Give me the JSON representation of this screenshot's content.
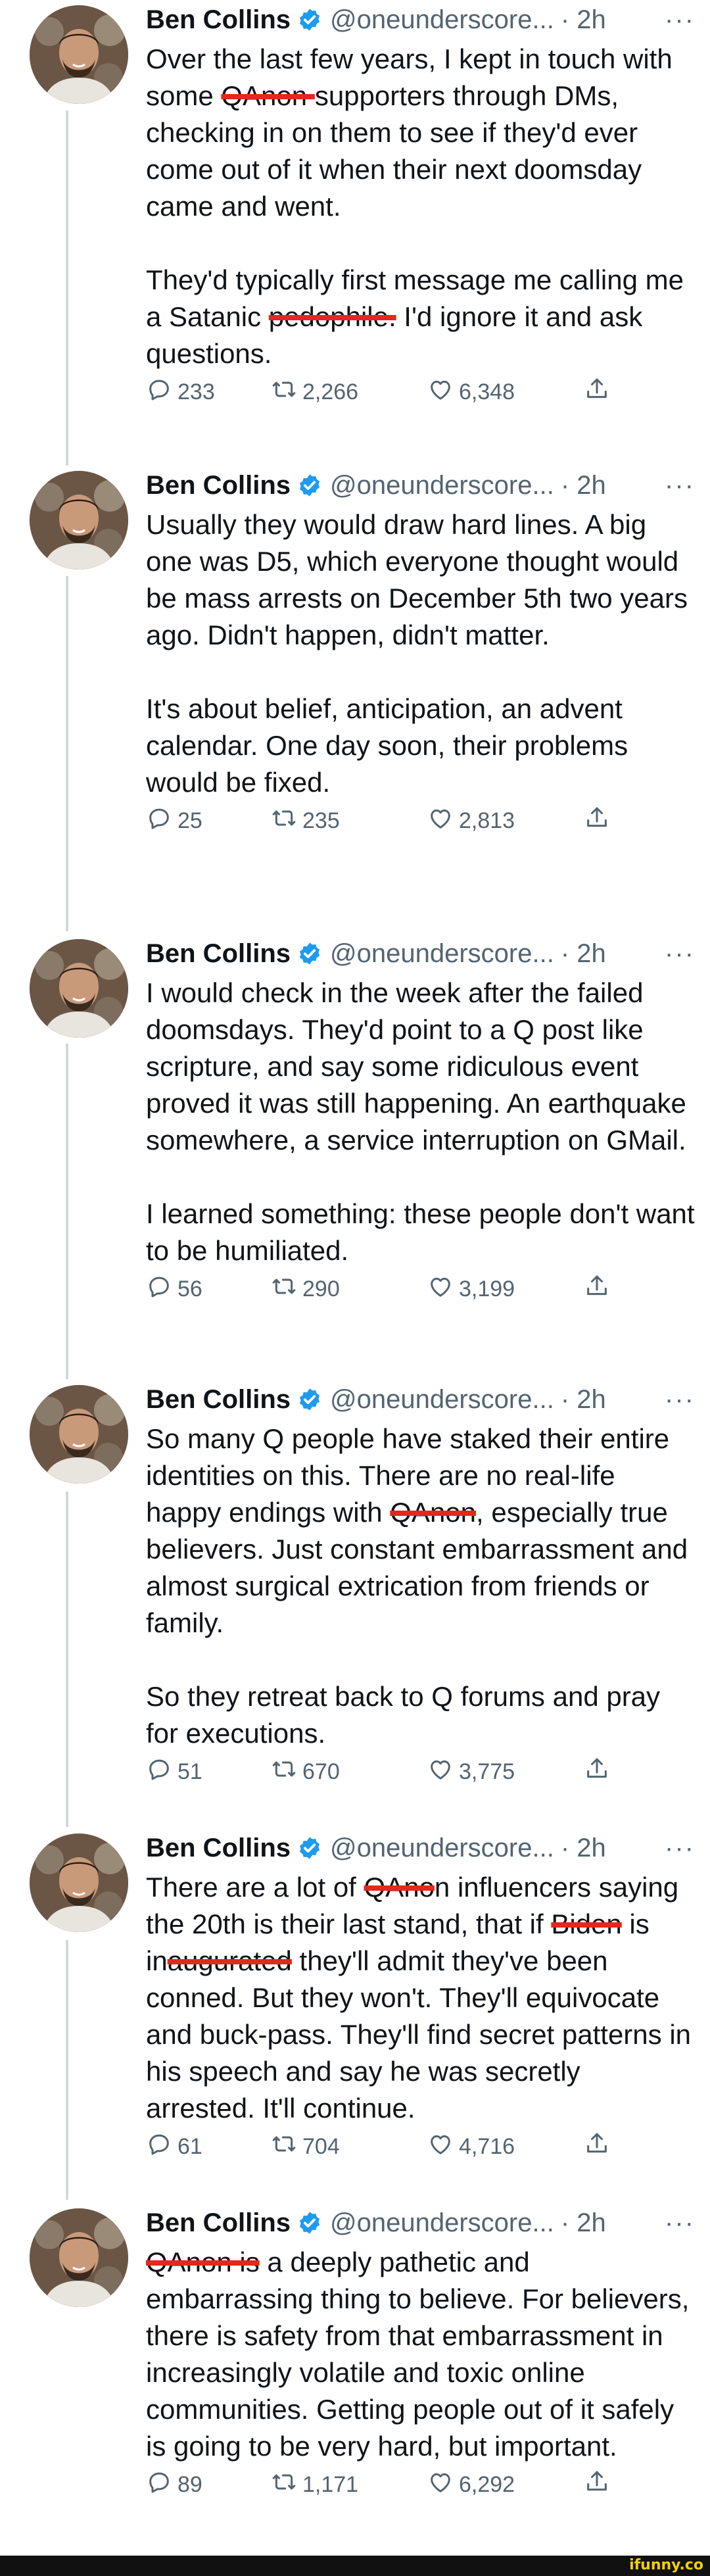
{
  "colors": {
    "accent": "#1d9bf0",
    "redaction": "#e3281c",
    "secondary_text": "#536471"
  },
  "tweets": [
    {
      "name": "Ben Collins",
      "handle": "@oneunderscore...",
      "time": "· 2h",
      "more": "···",
      "segments": [
        {
          "t": "Over the last few years, I kept in touch with some "
        },
        {
          "t": "QAnon ",
          "r": true
        },
        {
          "t": "supporters through DMs, checking in on them to see if they'd ever come out of it when their next doomsday came and went.\n\nThey'd typically first message me calling me a Satanic "
        },
        {
          "t": "pedophile.",
          "r": true
        },
        {
          "t": " I'd ignore it and ask questions."
        }
      ],
      "replies": "233",
      "retweets": "2,266",
      "likes": "6,348"
    },
    {
      "name": "Ben Collins",
      "handle": "@oneunderscore...",
      "time": "· 2h",
      "more": "···",
      "segments": [
        {
          "t": "Usually they would draw hard lines. A big one was D5, which everyone thought would be mass arrests on December 5th two years ago. Didn't happen, didn't matter.\n\nIt's about belief, anticipation, an advent calendar. One day soon, their problems would be fixed."
        }
      ],
      "replies": "25",
      "retweets": "235",
      "likes": "2,813"
    },
    {
      "name": "Ben Collins",
      "handle": "@oneunderscore...",
      "time": "· 2h",
      "more": "···",
      "segments": [
        {
          "t": "I would check in the week after the failed doomsdays. They'd point to a Q post like scripture, and say some ridiculous event proved it was still happening. An earthquake somewhere, a service interruption on GMail.\n\nI learned something: these people don't want to be humiliated."
        }
      ],
      "replies": "56",
      "retweets": "290",
      "likes": "3,199"
    },
    {
      "name": "Ben Collins",
      "handle": "@oneunderscore...",
      "time": "· 2h",
      "more": "···",
      "segments": [
        {
          "t": "So many Q people have staked their entire identities on this. There are no real-life happy endings with "
        },
        {
          "t": "QAnon",
          "r": true
        },
        {
          "t": ", especially true believers. Just constant embarrassment and almost surgical extrication from friends or family.\n\nSo they retreat back to Q forums and pray for executions."
        }
      ],
      "replies": "51",
      "retweets": "670",
      "likes": "3,775"
    },
    {
      "name": "Ben Collins",
      "handle": "@oneunderscore...",
      "time": "· 2h",
      "more": "···",
      "segments": [
        {
          "t": "There are a lot of "
        },
        {
          "t": "QAno",
          "r": true
        },
        {
          "t": "n influencers saying the 20th is their last stand, that if "
        },
        {
          "t": "Biden",
          "r": true
        },
        {
          "t": " is in"
        },
        {
          "t": "augurated",
          "r": true
        },
        {
          "t": " they'll admit they've been conned. But they won't. They'll equivocate and buck-pass. They'll find secret patterns in his speech and say he was secretly arrested. It'll continue."
        }
      ],
      "replies": "61",
      "retweets": "704",
      "likes": "4,716"
    },
    {
      "name": "Ben Collins",
      "handle": "@oneunderscore...",
      "time": "· 2h",
      "more": "···",
      "segments": [
        {
          "t": "QAnon is",
          "r": true
        },
        {
          "t": " a deeply pathetic and embarrassing thing to believe. For believers, there is safety from that embarrassment in increasingly volatile and toxic online communities. Getting people out of it safely is going to be very hard, but important."
        }
      ],
      "replies": "89",
      "retweets": "1,171",
      "likes": "6,292"
    }
  ],
  "footer": {
    "logo": "ifunny.co"
  }
}
